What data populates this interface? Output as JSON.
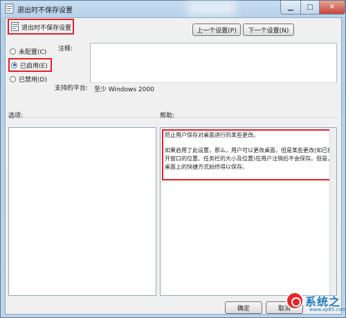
{
  "window": {
    "title": "退出时不保存设置"
  },
  "policy": {
    "title": "退出时不保存设置"
  },
  "nav": {
    "prev_label": "上一个设置(P)",
    "next_label": "下一个设置(N)"
  },
  "radios": [
    {
      "label": "未配置(C)",
      "checked": false
    },
    {
      "label": "已启用(E)",
      "checked": true
    },
    {
      "label": "已禁用(D)",
      "checked": false
    }
  ],
  "comment": {
    "label": "注释:",
    "value": ""
  },
  "platform": {
    "label": "支持的平台:",
    "value": "至少 Windows 2000"
  },
  "options": {
    "label": "选项:"
  },
  "help": {
    "label": "帮助:",
    "paragraph1": "防止用户保存对桌面进行的某些更改。",
    "paragraph2": "如果启用了此设置，那么，用户可以更改桌面，但是某些更改(如已打开窗口的位置、任务栏的大小及位置)在用户注销后不会保存。但是，桌面上的快捷方式始终得以保存。"
  },
  "footer": {
    "ok_label": "确定",
    "cancel_label": "取消"
  },
  "watermark": {
    "brand": "系统之",
    "url": "www.xp85.com"
  },
  "colors": {
    "highlight_border": "#e0202a",
    "window_frame": "#b5cfe8",
    "watermark": "#1978b9"
  }
}
